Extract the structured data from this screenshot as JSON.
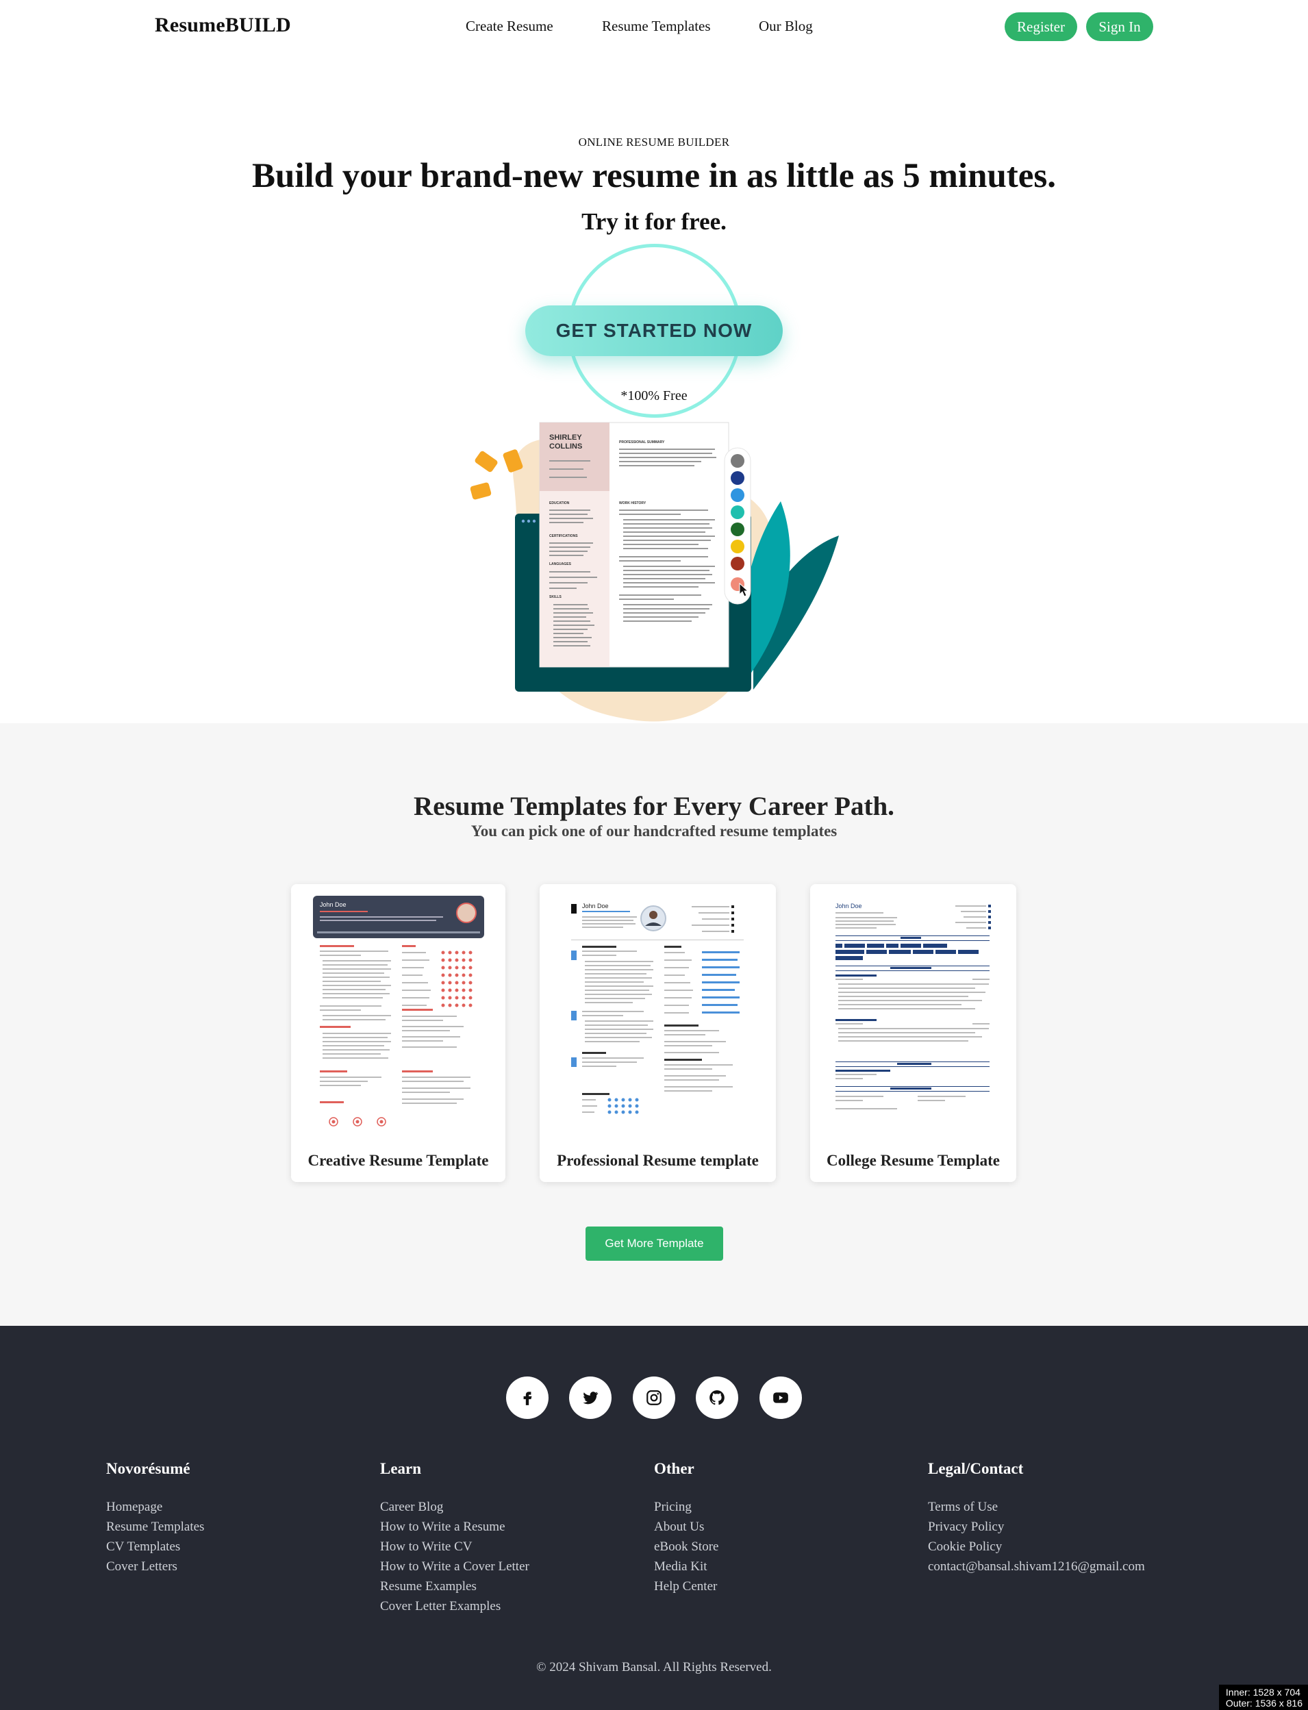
{
  "nav": {
    "logo": "ResumeBUILD",
    "links": [
      "Create Resume",
      "Resume Templates",
      "Our Blog"
    ],
    "register": "Register",
    "signin": "Sign In"
  },
  "hero": {
    "kicker": "ONLINE RESUME BUILDER",
    "title": "Build your brand-new resume in as little as 5 minutes.",
    "subtitle": "Try it for free.",
    "cta": "GET STARTED NOW",
    "note": "*100% Free",
    "resume_name_line1": "SHIRLEY",
    "resume_name_line2": "COLLINS",
    "resume_heading_summary": "PROFESSIONAL SUMMARY",
    "resume_heading_work": "WORK HISTORY",
    "resume_heading_education": "EDUCATION",
    "resume_heading_cert": "CERTIFICATIONS",
    "resume_heading_languages": "LANGUAGES",
    "resume_heading_skills": "SKILLS",
    "palette": [
      "#7a7a7a",
      "#1d3a8a",
      "#2f95e0",
      "#1fbfae",
      "#1f6b2a",
      "#f2c20f",
      "#a2321f",
      "#f08a78"
    ]
  },
  "templates": {
    "title": "Resume Templates for Every Career Path.",
    "subtitle": "You can pick one of our handcrafted resume templates",
    "cards": [
      {
        "label": "Creative Resume Template",
        "name": "John Doe"
      },
      {
        "label": "Professional Resume template",
        "name": "John Doe"
      },
      {
        "label": "College Resume Template",
        "name": "John Doe"
      }
    ],
    "more_button": "Get More Template"
  },
  "footer": {
    "social": [
      "facebook-icon",
      "twitter-icon",
      "instagram-icon",
      "github-icon",
      "youtube-icon"
    ],
    "columns": [
      {
        "title": "Novorésumé",
        "items": [
          "Homepage",
          "Resume Templates",
          "CV Templates",
          "Cover Letters"
        ]
      },
      {
        "title": "Learn",
        "items": [
          "Career Blog",
          "How to Write a Resume",
          "How to Write CV",
          "How to Write a Cover Letter",
          "Resume Examples",
          "Cover Letter Examples"
        ]
      },
      {
        "title": "Other",
        "items": [
          "Pricing",
          "About Us",
          "eBook Store",
          "Media Kit",
          "Help Center"
        ]
      },
      {
        "title": "Legal/Contact",
        "items": [
          "Terms of Use",
          "Privacy Policy",
          "Cookie Policy",
          "contact@bansal.shivam1216@gmail.com"
        ]
      }
    ],
    "copyright": "© 2024 Shivam Bansal. All Rights Reserved."
  },
  "viewport_overlay": {
    "inner": "Inner: 1528 x 704",
    "outer": "Outer: 1536 x 816"
  },
  "colors": {
    "accent_green": "#2fb36a",
    "cta_teal": "#5fd2c7",
    "footer_bg": "#262933",
    "section_bg": "#f6f6f6"
  }
}
